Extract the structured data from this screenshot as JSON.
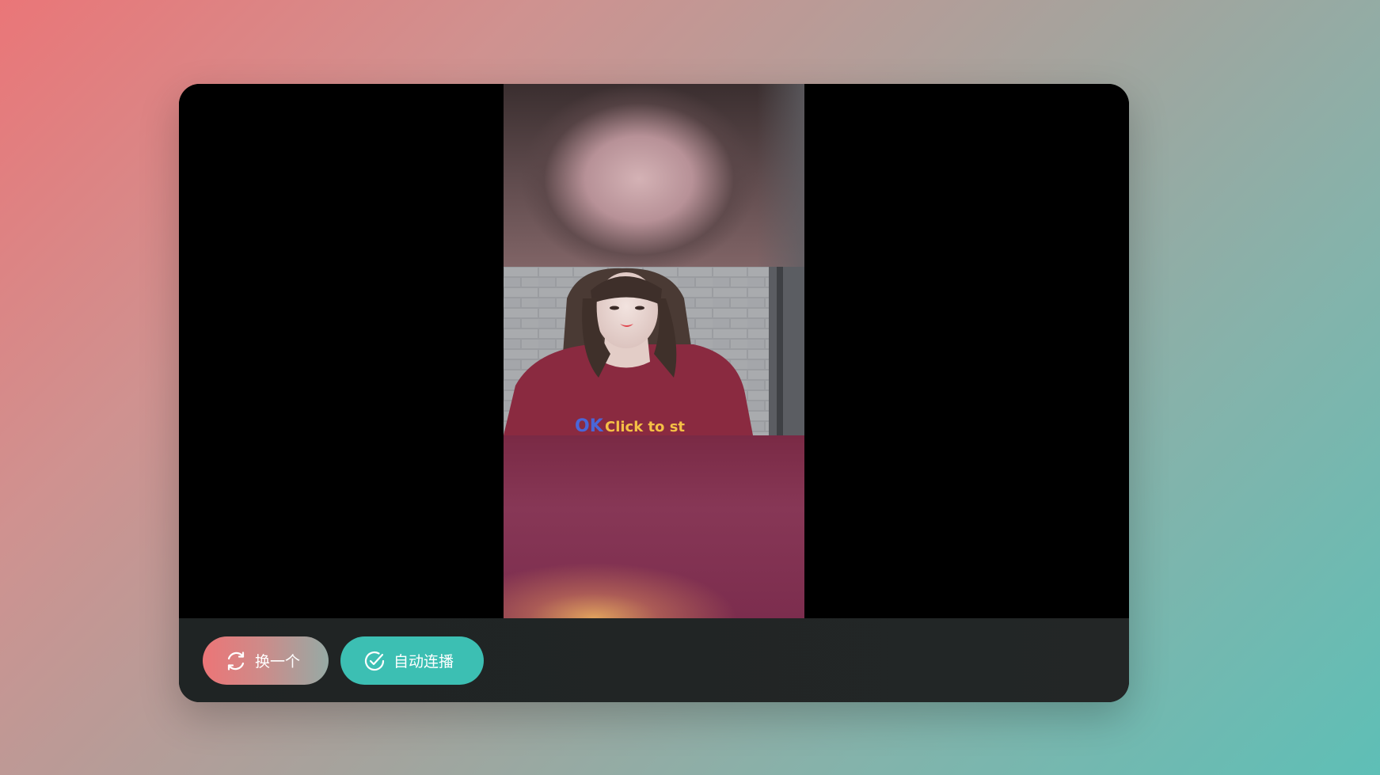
{
  "player": {
    "video": {
      "overlay_text": "OK Click to st"
    },
    "controls": {
      "switch_button": {
        "label": "换一个",
        "icon": "refresh-icon"
      },
      "autoplay_button": {
        "label": "自动连播",
        "icon": "check-circle-icon"
      }
    }
  },
  "colors": {
    "switch_gradient_start": "#ec7577",
    "switch_gradient_end": "#96aaa5",
    "autoplay_bg": "#3cbfb3",
    "control_bar_bg": "#222626"
  }
}
